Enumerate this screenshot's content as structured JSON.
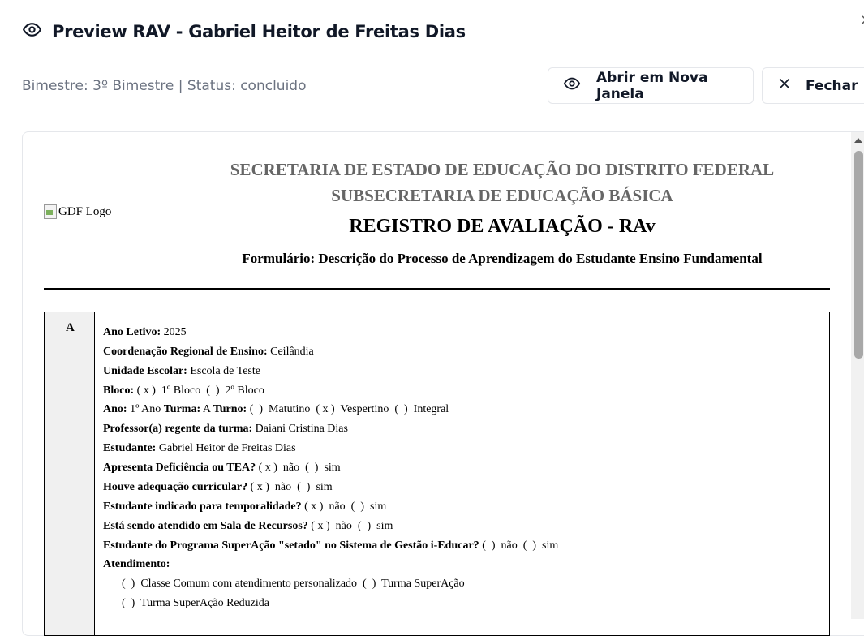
{
  "dialog": {
    "title": "Preview RAV - Gabriel Heitor de Freitas Dias",
    "subtitle": "Bimestre: 3º Bimestre | Status: concluido",
    "close_glyph": "×",
    "open_button": "Abrir em Nova Janela",
    "close_button": "Fechar"
  },
  "icons": {
    "title": "eye-icon",
    "open": "eye-icon",
    "close": "x-icon"
  },
  "document": {
    "logo_alt": "GDF Logo",
    "header_line1": "SECRETARIA DE ESTADO DE EDUCAÇÃO DO DISTRITO FEDERAL",
    "header_line2": "SUBSECRETARIA DE EDUCAÇÃO BÁSICA",
    "title": "REGISTRO DE AVALIAÇÃO - RAv",
    "form_title": "Formulário: Descrição do Processo de Aprendizagem do Estudante Ensino Fundamental",
    "section_letter": "A",
    "fields": {
      "ano_letivo_label": "Ano Letivo:",
      "ano_letivo": "2025",
      "cre_label": "Coordenação Regional de Ensino:",
      "cre": "Ceilândia",
      "unidade_label": "Unidade Escolar:",
      "unidade": "Escola de Teste",
      "bloco_label": "Bloco:",
      "bloco_opts": "( x )  1º Bloco  (  )  2º Bloco",
      "ano_label": "Ano:",
      "ano": "1º Ano",
      "turma_label": "Turma:",
      "turma": "A",
      "turno_label": "Turno:",
      "turno_opts": "(  )  Matutino  ( x )  Vespertino  (  )  Integral",
      "professor_label": "Professor(a) regente da turma:",
      "professor": "Daiani Cristina Dias",
      "estudante_label": "Estudante:",
      "estudante": "Gabriel Heitor de Freitas Dias",
      "deficiencia_label": "Apresenta Deficiência ou TEA?",
      "deficiencia_opts": "( x )  não  (  )  sim",
      "adequacao_label": "Houve adequação curricular?",
      "adequacao_opts": "( x )  não  (  )  sim",
      "temporalidade_label": "Estudante indicado para temporalidade?",
      "temporalidade_opts": "( x )  não  (  )  sim",
      "recursos_label": "Está sendo atendido em Sala de Recursos?",
      "recursos_opts": "( x )  não  (  )  sim",
      "superacao_label": "Estudante do Programa SuperAção \"setado\" no Sistema de Gestão i-Educar?",
      "superacao_opts": "(  )  não  (  )  sim",
      "atendimento_label": "Atendimento:",
      "atendimento_line1": "(  )  Classe Comum com atendimento personalizado  (  )  Turma SuperAção",
      "atendimento_line2": "(  )  Turma SuperAção Reduzida"
    }
  }
}
